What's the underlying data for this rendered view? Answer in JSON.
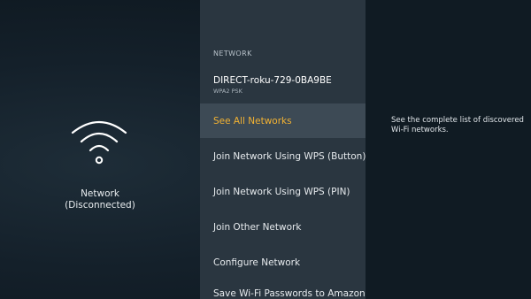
{
  "left": {
    "icon": "wifi-icon",
    "status_title": "Network",
    "status_detail": "(Disconnected)"
  },
  "network_menu": {
    "section_header": "NETWORK",
    "connected": {
      "name": "DIRECT-roku-729-0BA9BE",
      "security": "WPA2 PSK"
    },
    "items": [
      {
        "label": "See All Networks",
        "selected": true
      },
      {
        "label": "Join Network Using WPS (Button)",
        "selected": false
      },
      {
        "label": "Join Network Using WPS (PIN)",
        "selected": false
      },
      {
        "label": "Join Other Network",
        "selected": false
      },
      {
        "label": "Configure Network",
        "selected": false
      },
      {
        "label": "Save Wi-Fi Passwords to Amazon",
        "selected": false
      }
    ]
  },
  "right": {
    "description": "See the complete list of discovered Wi-Fi networks."
  },
  "colors": {
    "accent": "#f2b233",
    "menu_background": "#2a3640",
    "selected_background": "#3d4a55"
  }
}
